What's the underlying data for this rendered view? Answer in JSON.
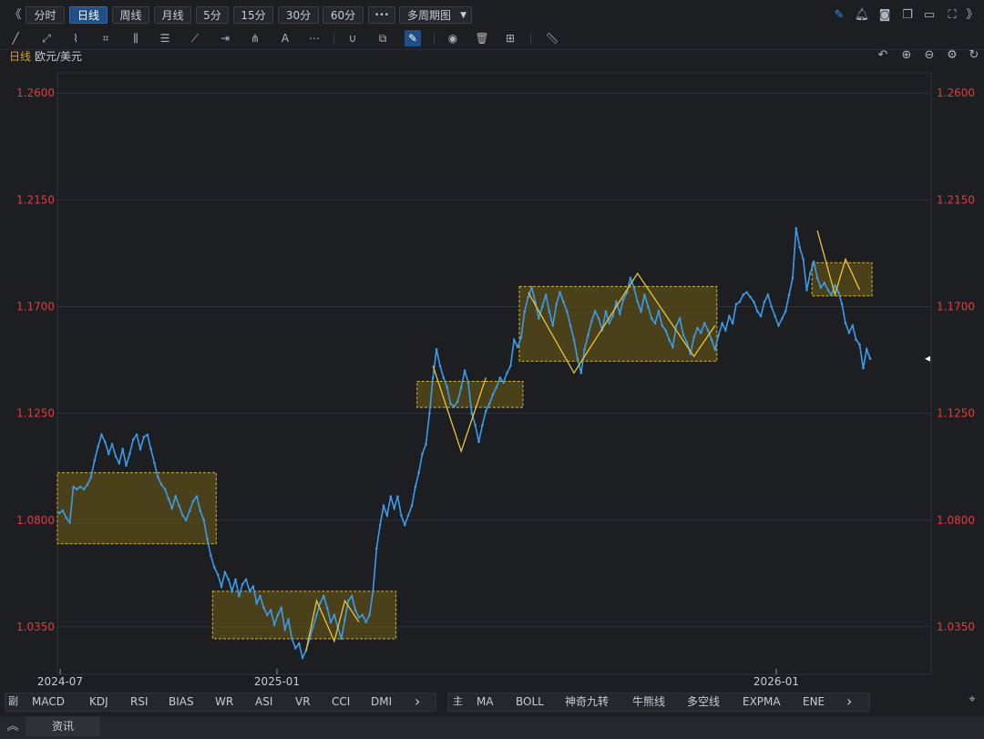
{
  "toolbar": {
    "collapse_left": "《",
    "periods": [
      "分时",
      "日线",
      "周线",
      "月线",
      "5分",
      "15分",
      "30分",
      "60分"
    ],
    "active_period": "日线",
    "more": "•••",
    "multi_period": "多周期图",
    "expand_right": "》"
  },
  "chart_header": {
    "period": "日线",
    "symbol": "欧元/美元"
  },
  "bottom_bar": {
    "sub_indicators_icon": "副",
    "sub_indicators": [
      "MACD",
      "KDJ",
      "RSI",
      "BIAS",
      "WR",
      "ASI",
      "VR",
      "CCI",
      "DMI"
    ],
    "main_indicators_icon": "主",
    "main_indicators": [
      "MA",
      "BOLL",
      "神奇九转",
      "牛熊线",
      "多空线",
      "EXPMA",
      "ENE"
    ],
    "more_arrow": "›"
  },
  "news_tab": "资讯",
  "colors": {
    "line": "#3d9be9",
    "box_fill": "#5a4e1a",
    "box_border": "#d9b53a",
    "zigzag": "#e8c33c",
    "axis_label": "#e23c3c",
    "grid": "#2e3138"
  },
  "chart_data": {
    "type": "line",
    "title": "",
    "y_ticks": [
      "1.2600",
      "1.2150",
      "1.1700",
      "1.1250",
      "1.0800",
      "1.0350"
    ],
    "ylim": [
      1.015,
      1.2685
    ],
    "x_ticks": [
      "2024-07",
      "2025-01",
      "2026-01"
    ],
    "grid": true,
    "series": [
      {
        "values": [
          1.083,
          1.084,
          1.081,
          1.079,
          1.094,
          1.093,
          1.094,
          1.093,
          1.095,
          1.098,
          1.105,
          1.111,
          1.116,
          1.113,
          1.108,
          1.112,
          1.107,
          1.104,
          1.11,
          1.103,
          1.108,
          1.114,
          1.116,
          1.11,
          1.115,
          1.116,
          1.11,
          1.104,
          1.098,
          1.095,
          1.093,
          1.089,
          1.085,
          1.09,
          1.086,
          1.082,
          1.08,
          1.084,
          1.088,
          1.09,
          1.084,
          1.08,
          1.072,
          1.065,
          1.06,
          1.057,
          1.052,
          1.058,
          1.055,
          1.05,
          1.055,
          1.048,
          1.053,
          1.055,
          1.05,
          1.052,
          1.045,
          1.048,
          1.043,
          1.04,
          1.042,
          1.036,
          1.04,
          1.043,
          1.034,
          1.038,
          1.03,
          1.026,
          1.028,
          1.022,
          1.025,
          1.03,
          1.035,
          1.04,
          1.045,
          1.048,
          1.043,
          1.037,
          1.04,
          1.035,
          1.03,
          1.038,
          1.046,
          1.048,
          1.042,
          1.039,
          1.04,
          1.037,
          1.04,
          1.05,
          1.068,
          1.078,
          1.086,
          1.082,
          1.09,
          1.085,
          1.09,
          1.082,
          1.078,
          1.082,
          1.086,
          1.094,
          1.1,
          1.108,
          1.112,
          1.125,
          1.14,
          1.152,
          1.145,
          1.14,
          1.136,
          1.129,
          1.128,
          1.13,
          1.136,
          1.143,
          1.138,
          1.125,
          1.12,
          1.113,
          1.12,
          1.126,
          1.129,
          1.133,
          1.136,
          1.14,
          1.138,
          1.142,
          1.145,
          1.156,
          1.153,
          1.157,
          1.168,
          1.174,
          1.178,
          1.172,
          1.165,
          1.17,
          1.175,
          1.168,
          1.162,
          1.171,
          1.176,
          1.172,
          1.168,
          1.162,
          1.156,
          1.148,
          1.142,
          1.152,
          1.158,
          1.164,
          1.168,
          1.165,
          1.16,
          1.168,
          1.163,
          1.166,
          1.172,
          1.167,
          1.173,
          1.176,
          1.182,
          1.178,
          1.172,
          1.168,
          1.175,
          1.17,
          1.165,
          1.163,
          1.168,
          1.162,
          1.16,
          1.156,
          1.153,
          1.162,
          1.165,
          1.158,
          1.155,
          1.15,
          1.157,
          1.161,
          1.159,
          1.163,
          1.16,
          1.156,
          1.152,
          1.158,
          1.163,
          1.16,
          1.166,
          1.163,
          1.171,
          1.172,
          1.175,
          1.176,
          1.174,
          1.172,
          1.168,
          1.166,
          1.172,
          1.175,
          1.17,
          1.166,
          1.162,
          1.165,
          1.168,
          1.175,
          1.182,
          1.203,
          1.195,
          1.19,
          1.177,
          1.184,
          1.189,
          1.182,
          1.178,
          1.18,
          1.177,
          1.175,
          1.179,
          1.176,
          1.171,
          1.163,
          1.159,
          1.162,
          1.156,
          1.154,
          1.144,
          1.152,
          1.148
        ]
      }
    ],
    "last_value": 1.148,
    "highlight_boxes": [
      {
        "x0_index": 0,
        "x1_index": 44,
        "y0": 1.1,
        "y1": 1.07
      },
      {
        "x0_index": 44,
        "x1_index": 95,
        "y0": 1.05,
        "y1": 1.03
      },
      {
        "x0_index": 102,
        "x1_index": 131,
        "y0": 1.1385,
        "y1": 1.1275
      },
      {
        "x0_index": 131,
        "x1_index": 186,
        "y0": 1.1785,
        "y1": 1.147
      },
      {
        "x0_index": 214,
        "x1_index": 230,
        "y0": 1.1885,
        "y1": 1.1745
      }
    ],
    "zigzag_lines": [
      [
        [
          70,
          1.025
        ],
        [
          73,
          1.046
        ],
        [
          78,
          1.029
        ],
        [
          81,
          1.046
        ],
        [
          85,
          1.037
        ]
      ],
      [
        [
          106,
          1.145
        ],
        [
          114,
          1.109
        ],
        [
          121,
          1.14
        ]
      ],
      [
        [
          133,
          1.176
        ],
        [
          146,
          1.142
        ],
        [
          164,
          1.184
        ],
        [
          180,
          1.149
        ],
        [
          186,
          1.162
        ]
      ],
      [
        [
          215,
          1.202
        ],
        [
          220,
          1.175
        ],
        [
          223,
          1.19
        ],
        [
          227,
          1.177
        ]
      ]
    ]
  }
}
